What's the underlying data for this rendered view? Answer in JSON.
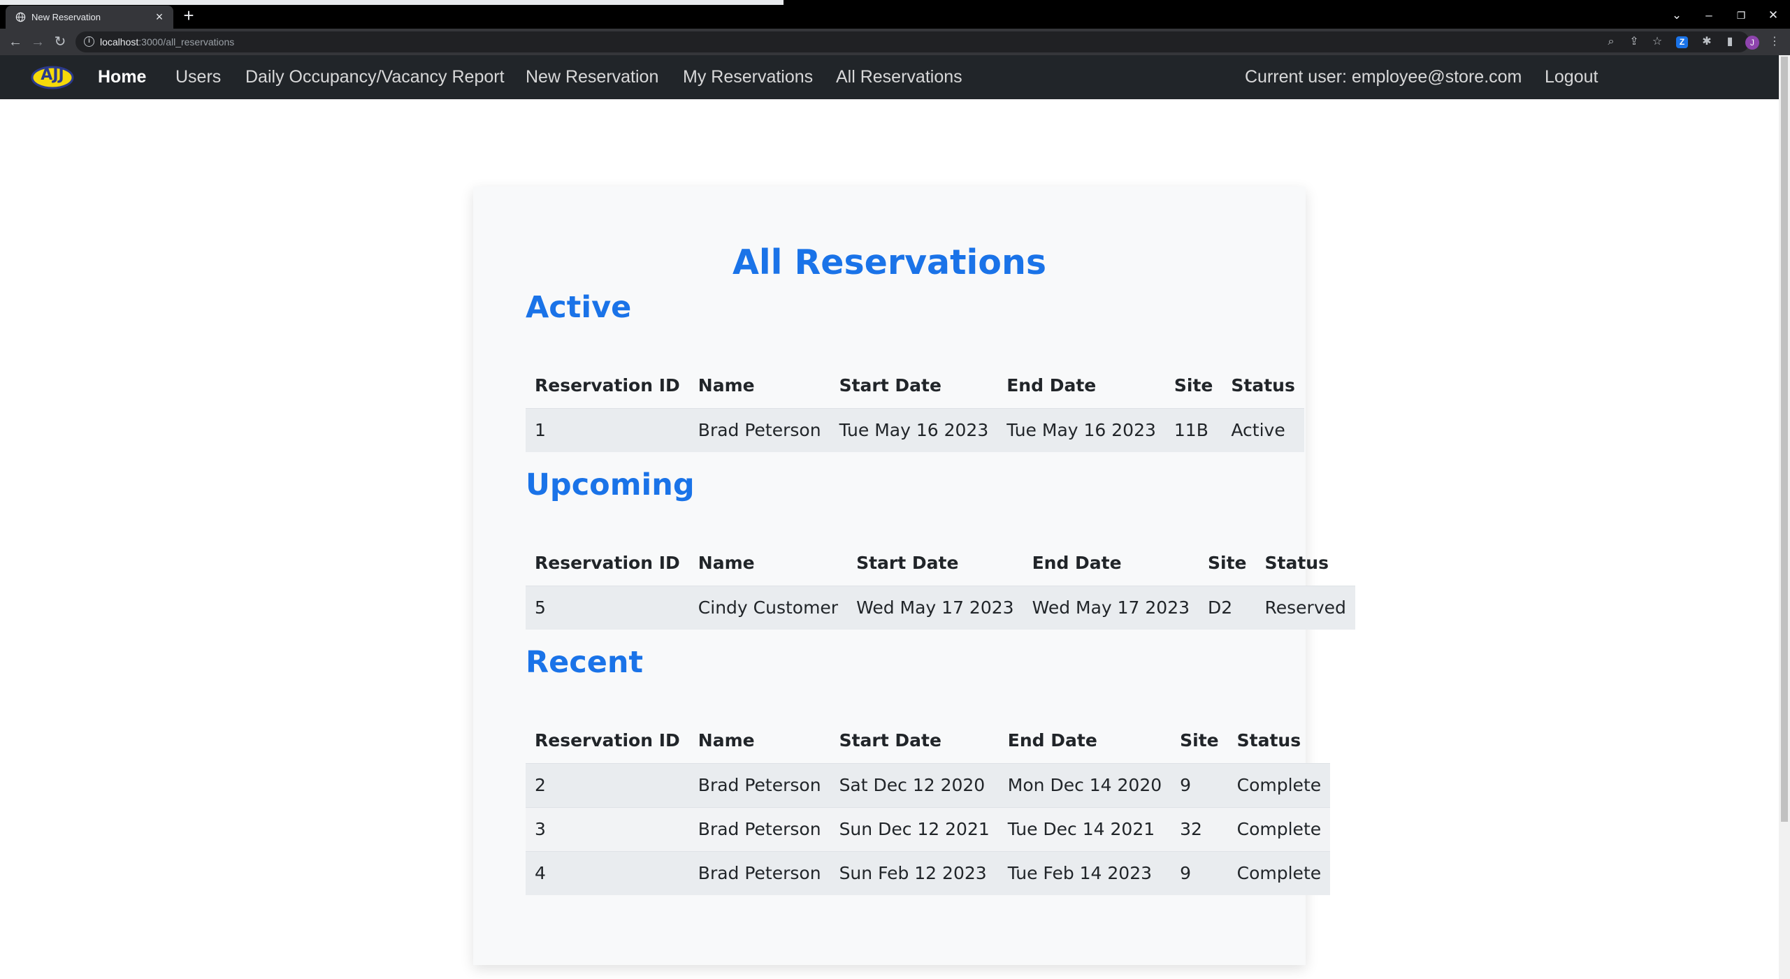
{
  "browser": {
    "tab_title": "New Reservation",
    "url_host": "localhost",
    "url_rest": ":3000/all_reservations",
    "profile_initial": "J",
    "z_icon": "Z"
  },
  "nav": {
    "logo_text": "AJJ",
    "home": "Home",
    "users": "Users",
    "report": "Daily Occupancy/Vacancy Report",
    "new_reservation": "New Reservation",
    "my_reservations": "My Reservations",
    "all_reservations": "All Reservations",
    "current_user": "Current user: employee@store.com",
    "logout": "Logout"
  },
  "page": {
    "title": "All Reservations",
    "columns": [
      "Reservation ID",
      "Name",
      "Start Date",
      "End Date",
      "Site",
      "Status"
    ],
    "active": {
      "title": "Active",
      "rows": [
        [
          "1",
          "Brad Peterson",
          "Tue May 16 2023",
          "Tue May 16 2023",
          "11B",
          "Active"
        ]
      ]
    },
    "upcoming": {
      "title": "Upcoming",
      "rows": [
        [
          "5",
          "Cindy Customer",
          "Wed May 17 2023",
          "Wed May 17 2023",
          "D2",
          "Reserved"
        ]
      ]
    },
    "recent": {
      "title": "Recent",
      "rows": [
        [
          "2",
          "Brad Peterson",
          "Sat Dec 12 2020",
          "Mon Dec 14 2020",
          "9",
          "Complete"
        ],
        [
          "3",
          "Brad Peterson",
          "Sun Dec 12 2021",
          "Tue Dec 14 2021",
          "32",
          "Complete"
        ],
        [
          "4",
          "Brad Peterson",
          "Sun Feb 12 2023",
          "Tue Feb 14 2023",
          "9",
          "Complete"
        ]
      ]
    }
  },
  "colors": {
    "accent": "#1a73e8",
    "navbar": "#212529",
    "card": "#f8f9fa"
  }
}
